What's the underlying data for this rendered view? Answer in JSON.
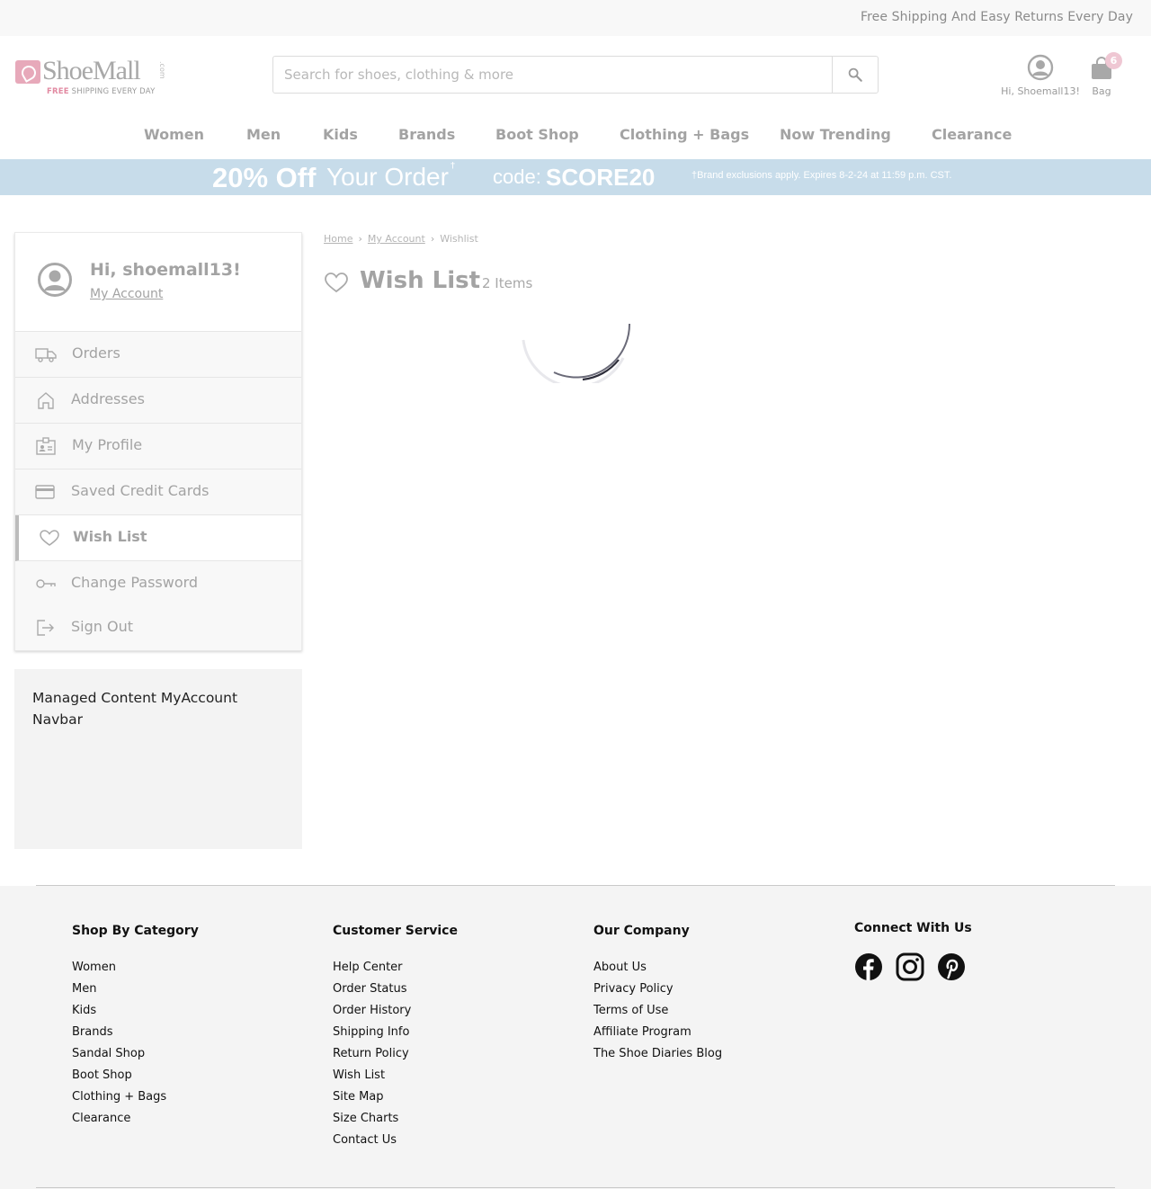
{
  "topbar": {
    "message": "Free Shipping And Easy Returns Every Day"
  },
  "header": {
    "logo_text": "ShoeMall",
    "logo_com": ".com",
    "logo_tag_accent": "FREE",
    "logo_tag_rest": "SHIPPING EVERY DAY",
    "search_placeholder": "Search for shoes, clothing & more",
    "account_label": "Hi, Shoemall13!",
    "bag_label": "Bag",
    "bag_count": "6"
  },
  "nav": [
    "Women",
    "Men",
    "Kids",
    "Brands",
    "Boot Shop",
    "Clothing + Bags",
    "Now Trending",
    "Clearance"
  ],
  "promo": {
    "discount": "20% Off",
    "text": "Your Order",
    "dagger": "†",
    "code_label": "code:",
    "code": "SCORE20",
    "fine_print": "†Brand exclusions apply. Expires 8-2-24 at 11:59 p.m. CST."
  },
  "sidebar": {
    "greeting": "Hi, shoemall13!",
    "account_link": "My Account",
    "items": [
      {
        "label": "Orders",
        "icon": "truck-icon"
      },
      {
        "label": "Addresses",
        "icon": "home-icon"
      },
      {
        "label": "My Profile",
        "icon": "id-card-icon"
      },
      {
        "label": "Saved Credit Cards",
        "icon": "credit-card-icon"
      },
      {
        "label": "Wish List",
        "icon": "heart-icon",
        "active": true
      },
      {
        "label": "Change Password",
        "icon": "key-icon"
      },
      {
        "label": "Sign Out",
        "icon": "sign-out-icon"
      }
    ],
    "managed_content": "Managed Content MyAccount Navbar"
  },
  "breadcrumb": [
    "Home",
    "My Account",
    "Wishlist"
  ],
  "wishlist": {
    "title": "Wish List",
    "count": "2 Items"
  },
  "footer": {
    "shop": {
      "heading": "Shop By Category",
      "links": [
        "Women",
        "Men",
        "Kids",
        "Brands",
        "Sandal Shop",
        "Boot Shop",
        "Clothing + Bags",
        "Clearance"
      ]
    },
    "service": {
      "heading": "Customer Service",
      "links": [
        "Help Center",
        "Order Status",
        "Order History",
        "Shipping Info",
        "Return Policy",
        "Wish List",
        "Site Map",
        "Size Charts",
        "Contact Us"
      ]
    },
    "company": {
      "heading": "Our Company",
      "links": [
        "About Us",
        "Privacy Policy",
        "Terms of Use",
        "Affiliate Program",
        "The Shoe Diaries Blog"
      ]
    },
    "connect": {
      "heading": "Connect With Us",
      "icons": [
        "facebook-icon",
        "instagram-icon",
        "pinterest-icon"
      ]
    }
  }
}
